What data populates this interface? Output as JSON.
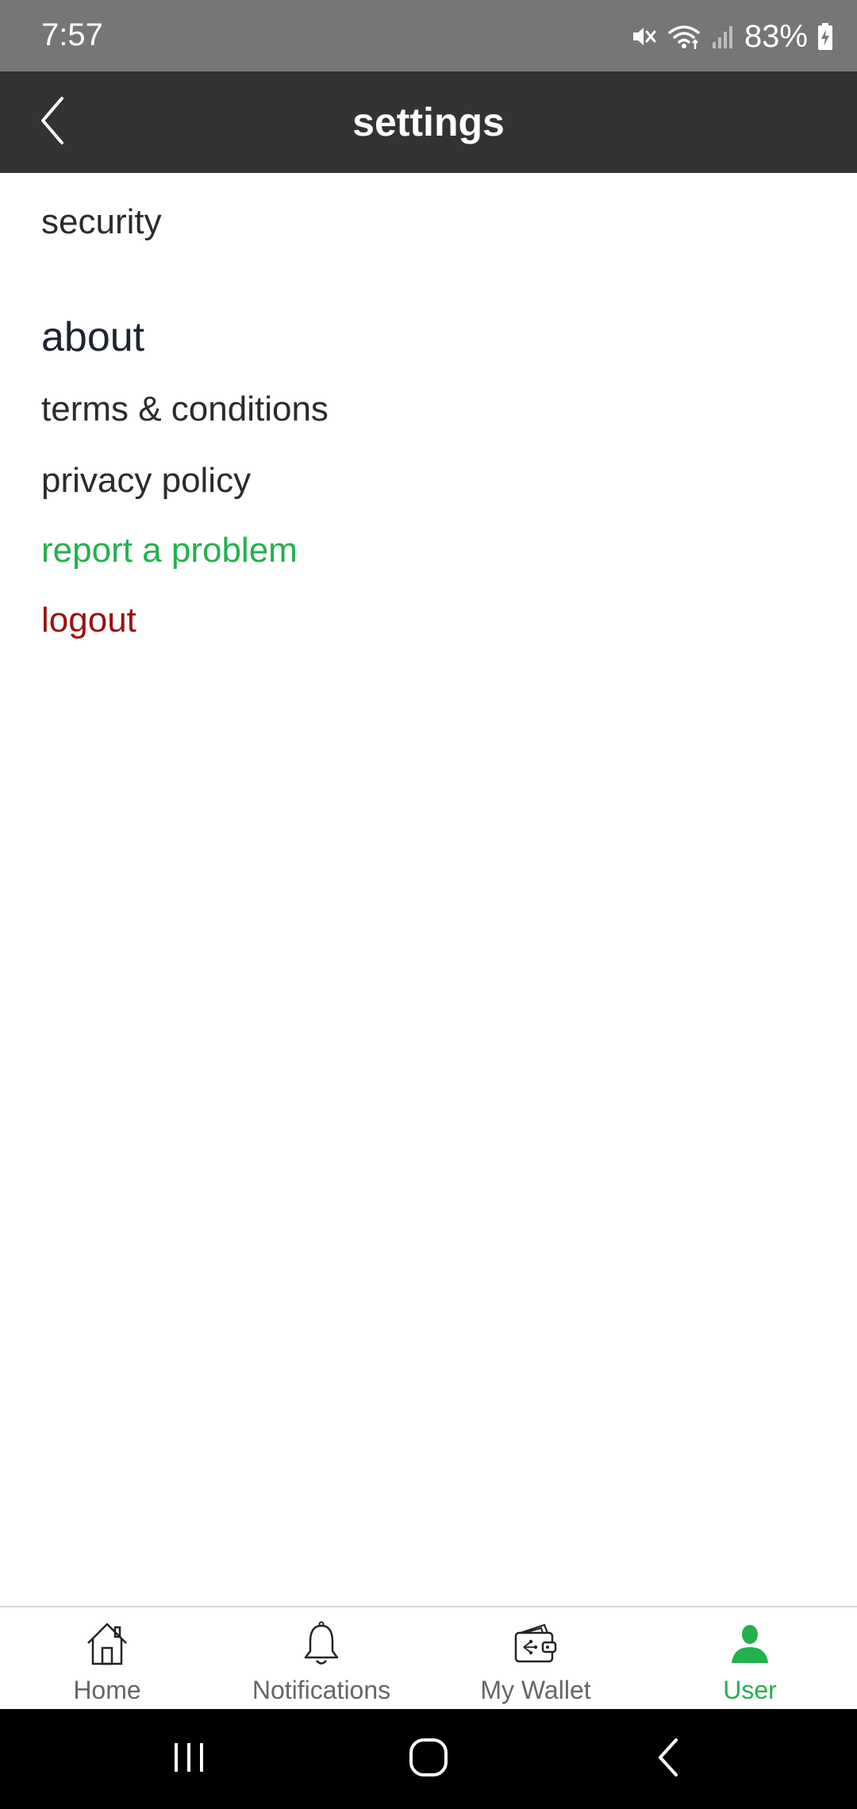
{
  "status_bar": {
    "time": "7:57",
    "battery_percent": "83%",
    "icons": [
      "mute-icon",
      "wifi-icon",
      "signal-icon",
      "battery-charging-icon"
    ]
  },
  "header": {
    "title": "settings",
    "back_icon": "chevron-left-icon"
  },
  "content": {
    "security_label": "security",
    "about_heading": "about",
    "terms_label": "terms & conditions",
    "privacy_label": "privacy policy",
    "report_label": "report a problem",
    "logout_label": "logout"
  },
  "bottom_nav": {
    "items": [
      {
        "label": "Home",
        "icon": "home-icon",
        "active": false
      },
      {
        "label": "Notifications",
        "icon": "bell-icon",
        "active": false
      },
      {
        "label": "My Wallet",
        "icon": "wallet-icon",
        "active": false
      },
      {
        "label": "User",
        "icon": "user-icon",
        "active": true
      }
    ]
  },
  "colors": {
    "status_bar_bg": "#767676",
    "header_bg": "#333333",
    "accent_green": "#22b14c",
    "logout_red": "#9b1111",
    "text_dark": "#2b2b2b",
    "nav_inactive": "#666666"
  }
}
